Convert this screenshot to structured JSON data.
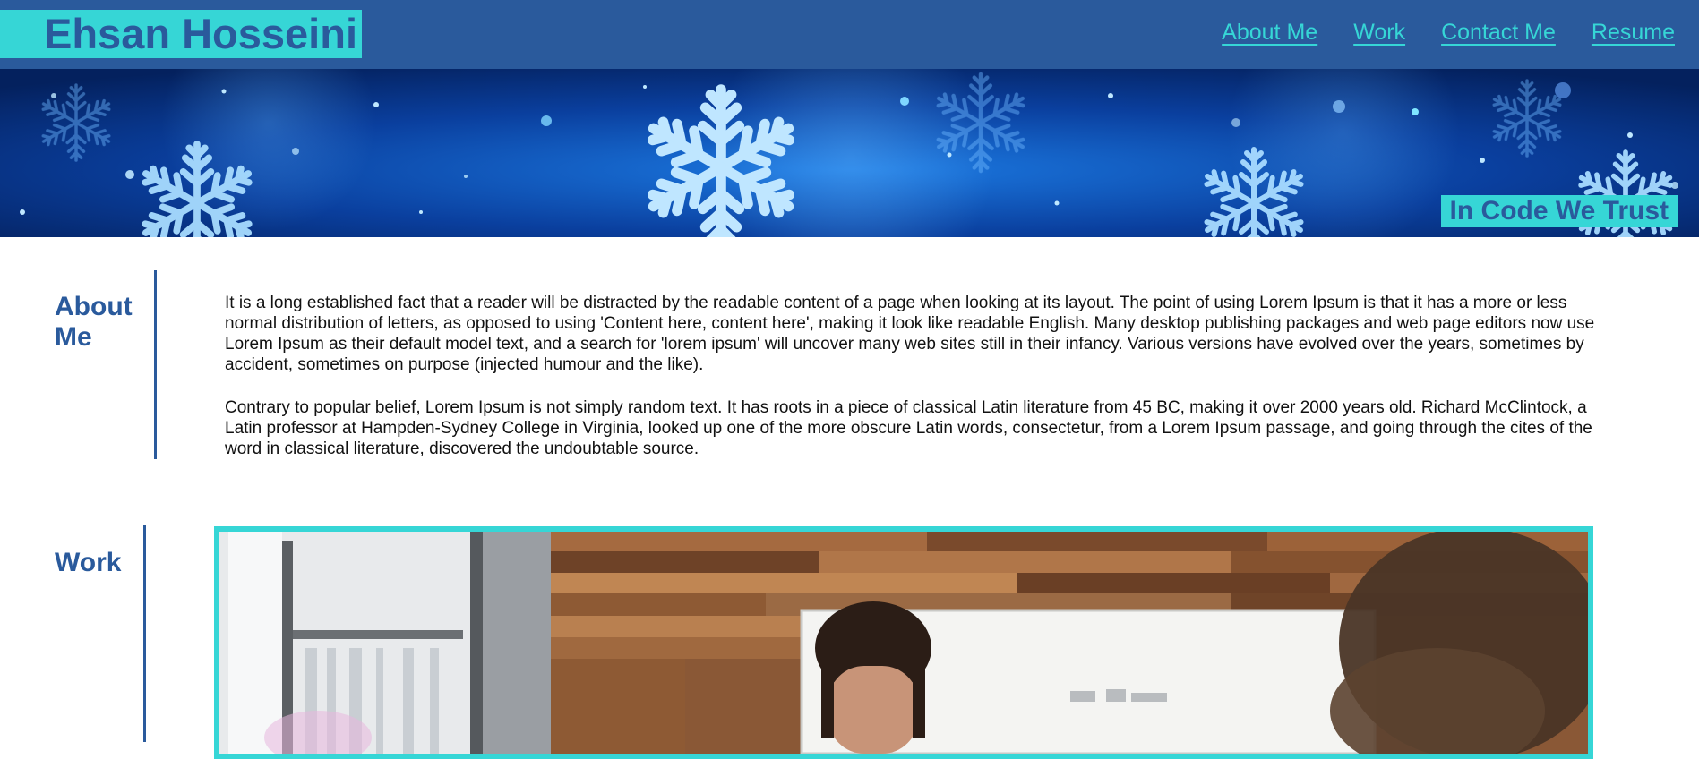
{
  "header": {
    "brand": "Ehsan Hosseini",
    "nav": [
      "About Me",
      "Work",
      "Contact Me",
      "Resume"
    ]
  },
  "hero": {
    "tagline": "In Code We Trust"
  },
  "about": {
    "title": "About Me",
    "paragraphs": [
      "It is a long established fact that a reader will be distracted by the readable content of a page when looking at its layout. The point of using Lorem Ipsum is that it has a more or less normal distribution of letters, as opposed to using 'Content here, content here', making it look like readable English. Many desktop publishing packages and web page editors now use Lorem Ipsum as their default model text, and a search for 'lorem ipsum' will uncover many web sites still in their infancy. Various versions have evolved over the years, sometimes by accident, sometimes on purpose (injected humour and the like).",
      "Contrary to popular belief, Lorem Ipsum is not simply random text. It has roots in a piece of classical Latin literature from 45 BC, making it over 2000 years old. Richard McClintock, a Latin professor at Hampden-Sydney College in Virginia, looked up one of the more obscure Latin words, consectetur, from a Lorem Ipsum passage, and going through the cites of the word in classical literature, discovered the undoubtable source."
    ]
  },
  "work": {
    "title": "Work"
  },
  "colors": {
    "primary": "#2a5a9c",
    "accent": "#36d6d6",
    "text": "#111111",
    "background": "#ffffff"
  },
  "icons": {
    "hero": "snowflake-banner",
    "work": "office-photo"
  }
}
